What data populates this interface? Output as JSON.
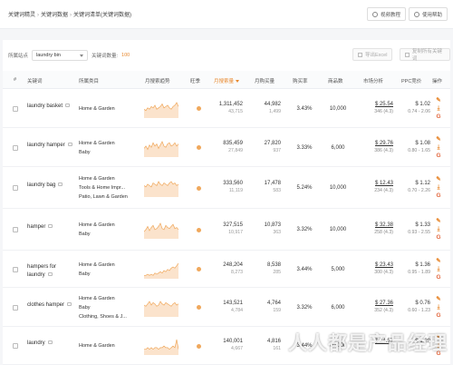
{
  "breadcrumb": [
    "关键词精灵",
    "关键词数据",
    "关键词清单(关键词数据)"
  ],
  "top_buttons": {
    "video": "视频教程",
    "help": "使用帮助"
  },
  "filters": {
    "site_label": "所属站点",
    "site_value": "laundry bin",
    "count_label": "关键词数量:",
    "count_value": "100"
  },
  "toolbar": {
    "export": "导出Excel",
    "copy": "复制所有关键词"
  },
  "columns": [
    "#",
    "关键词",
    "所属类目",
    "月搜索趋势",
    "旺季",
    "月搜索量",
    "月购买量",
    "购买率",
    "商品数",
    "市场分析",
    "PPC竞价",
    "操作"
  ],
  "rows": [
    {
      "keyword": "laundry basket",
      "categories": [
        "Home & Garden"
      ],
      "search_volume": "1,311,452",
      "search_sub": "43,715",
      "purchases": "44,982",
      "purchases_sub": "1,499",
      "rate": "3.43%",
      "products": "10,000",
      "market_price": "$ 25.54",
      "market_sub": "346 (4.3)",
      "ppc_price": "$ 1.02",
      "ppc_range": "0.74 - 2.06"
    },
    {
      "keyword": "laundry hamper",
      "categories": [
        "Home & Garden",
        "Baby"
      ],
      "search_volume": "835,459",
      "search_sub": "27,849",
      "purchases": "27,820",
      "purchases_sub": "937",
      "rate": "3.33%",
      "products": "6,000",
      "market_price": "$ 29.76",
      "market_sub": "386 (4.3)",
      "ppc_price": "$ 1.08",
      "ppc_range": "0.80 - 1.65"
    },
    {
      "keyword": "laundry bag",
      "categories": [
        "Home & Garden",
        "Tools & Home Impr...",
        "Patio, Lawn & Garden"
      ],
      "search_volume": "333,560",
      "search_sub": "11,119",
      "purchases": "17,478",
      "purchases_sub": "583",
      "rate": "5.24%",
      "products": "10,000",
      "market_price": "$ 12.43",
      "market_sub": "234 (4.3)",
      "ppc_price": "$ 1.12",
      "ppc_range": "0.70 - 2.26"
    },
    {
      "keyword": "hamper",
      "categories": [
        "Home & Garden",
        "Baby"
      ],
      "search_volume": "327,515",
      "search_sub": "10,917",
      "purchases": "10,873",
      "purchases_sub": "363",
      "rate": "3.32%",
      "products": "10,000",
      "market_price": "$ 32.38",
      "market_sub": "258 (4.3)",
      "ppc_price": "$ 1.33",
      "ppc_range": "0.93 - 2.55"
    },
    {
      "keyword": "hampers for laundry",
      "categories": [
        "Home & Garden",
        "Baby"
      ],
      "search_volume": "248,204",
      "search_sub": "8,273",
      "purchases": "8,538",
      "purchases_sub": "285",
      "rate": "3.44%",
      "products": "5,000",
      "market_price": "$ 23.43",
      "market_sub": "300 (4.3)",
      "ppc_price": "$ 1.36",
      "ppc_range": "0.95 - 1.89"
    },
    {
      "keyword": "clothes hamper",
      "categories": [
        "Home & Garden",
        "Baby",
        "Clothing, Shoes & J..."
      ],
      "search_volume": "143,521",
      "search_sub": "4,784",
      "purchases": "4,764",
      "purchases_sub": "159",
      "rate": "3.32%",
      "products": "6,000",
      "market_price": "$ 27.36",
      "market_sub": "352 (4.3)",
      "ppc_price": "$ 0.76",
      "ppc_range": "0.60 - 1.23"
    },
    {
      "keyword": "laundry",
      "categories": [
        "Home & Garden"
      ],
      "search_volume": "140,001",
      "search_sub": "4,667",
      "purchases": "4,816",
      "purchases_sub": "161",
      "rate": "3.44%",
      "products": "60,000",
      "market_price": "$ 24.57",
      "market_sub": "",
      "ppc_price": "$ 1.29",
      "ppc_range": ""
    }
  ],
  "watermark": "人人都是产品经理",
  "accent_color": "#e8892f"
}
